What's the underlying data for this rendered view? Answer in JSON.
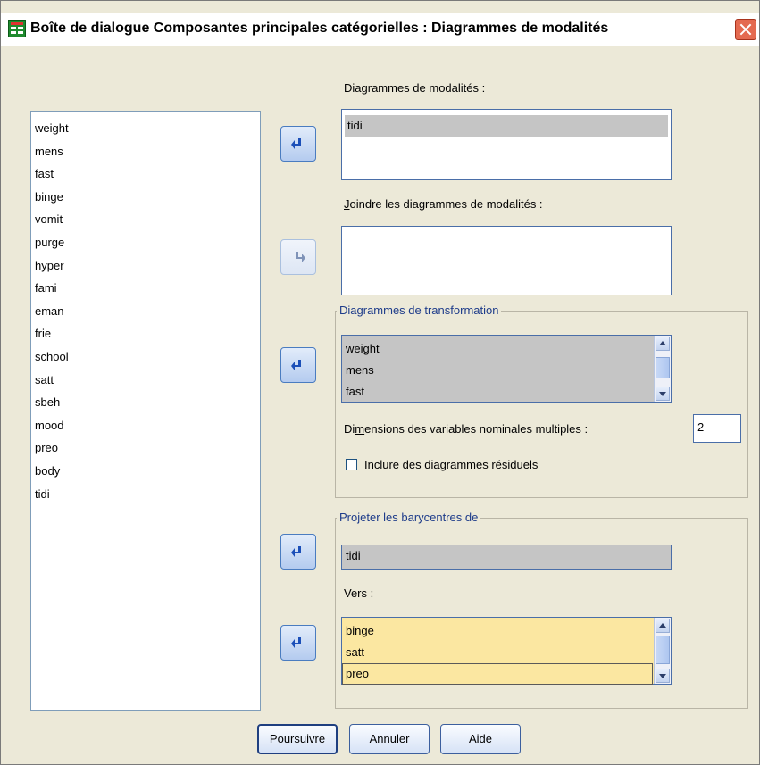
{
  "window": {
    "title": "Boîte de dialogue Composantes principales catégorielles : Diagrammes de modalités"
  },
  "variables": [
    "weight",
    "mens",
    "fast",
    "binge",
    "vomit",
    "purge",
    "hyper",
    "fami",
    "eman",
    "frie",
    "school",
    "satt",
    "sbeh",
    "mood",
    "preo",
    "body",
    "tidi"
  ],
  "category_plots": {
    "label": "Diagrammes de modalités :",
    "items": [
      "tidi"
    ]
  },
  "joint_category_plots": {
    "label": "Joindre les diagrammes de modalités :",
    "items": []
  },
  "transformation_plots": {
    "group_title": "Diagrammes de transformation",
    "items": [
      "weight",
      "mens",
      "fast"
    ],
    "dimensions_label": "Dimensions des variables nominales multiples :",
    "dimensions_value": "2",
    "residual_checkbox_label": "Inclure des diagrammes résiduels",
    "residual_checked": false
  },
  "project_centroids": {
    "group_title": "Projeter les barycentres de",
    "source_items": [
      "tidi"
    ],
    "onto_label": "Vers :",
    "onto_items": [
      "binge",
      "satt",
      "preo"
    ]
  },
  "buttons": {
    "continue": "Poursuivre",
    "cancel": "Annuler",
    "help": "Aide"
  },
  "colors": {
    "group_title": "#1e3c8a",
    "selection_gray": "#c5c5c5",
    "selection_yellow": "#fbe7a1"
  }
}
